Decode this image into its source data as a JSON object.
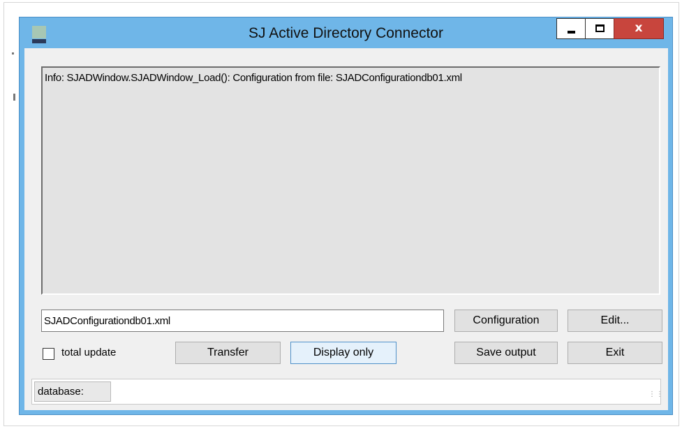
{
  "window": {
    "title": "SJ Active Directory Connector",
    "controls": {
      "close_glyph": "x"
    }
  },
  "log": {
    "lines": [
      "Info: SJADWindow.SJADWindow_Load(): Configuration from file: SJADConfigurationdb01.xml"
    ]
  },
  "config": {
    "file_value": "SJADConfigurationdb01.xml",
    "configuration_label": "Configuration",
    "edit_label": "Edit..."
  },
  "options": {
    "total_update_label": "total update",
    "total_update_checked": false
  },
  "actions": {
    "transfer_label": "Transfer",
    "display_only_label": "Display only",
    "save_output_label": "Save output",
    "exit_label": "Exit"
  },
  "status": {
    "database_label": "database:"
  },
  "colors": {
    "window_frame": "#6fb6e8",
    "close_button": "#c8453d",
    "focus_border": "#4f91c9"
  },
  "icons": [
    "app-icon",
    "minimize-icon",
    "maximize-icon",
    "close-icon",
    "resize-grip-icon"
  ]
}
